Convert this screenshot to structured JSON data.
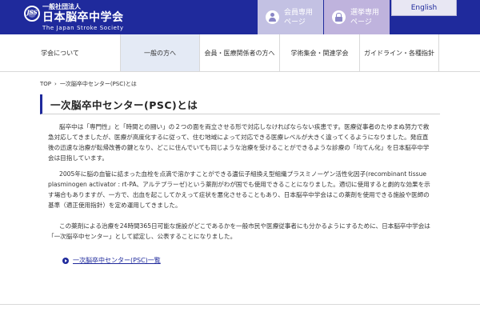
{
  "header": {
    "logo_sub": "一般社団法人",
    "logo_main": "日本脳卒中学会",
    "logo_en": "The Japan Stroke Society",
    "logo_mark": "JSS",
    "member_buttons": [
      {
        "line1": "会員専用",
        "line2": "ページ",
        "icon": "person-icon"
      },
      {
        "line1": "選挙専用",
        "line2": "ページ",
        "icon": "lock-icon"
      }
    ],
    "english_label": "English",
    "colors": {
      "primary": "#1f2a9c",
      "member1": "#c3c1e3",
      "member2": "#bfb3dd"
    }
  },
  "nav": {
    "items": [
      {
        "label": "学会について",
        "active": false
      },
      {
        "label": "一般の方へ",
        "active": true
      },
      {
        "label": "会員・医療関係者の方へ",
        "active": false
      },
      {
        "label": "学術集会・関連学会",
        "active": false
      },
      {
        "label": "ガイドライン・各種指針",
        "active": false
      }
    ]
  },
  "breadcrumb": {
    "home": "TOP",
    "separator": "›",
    "current": "一次脳卒中センター(PSC)とは"
  },
  "page": {
    "title": "一次脳卒中センター(PSC)とは",
    "paragraphs": [
      "脳卒中は「専門性」と「時間との闘い」の２つの面を両立させる形で対応しなければならない疾患です。医療従事者のたゆまぬ努力で救急対応してきましたが、医療が高度化するに従って、住む地域によって対応できる医療レベルが大きく違ってくるようになりました。発症直後の迅速な治療が転帰改善の鍵となり、どこに住んでいても同じような治療を受けることができるような診療の「均てん化」を日本脳卒中学会は目指しています。",
      "2005年に脳の血管に詰まった血栓を点滴で溶かすことができる遺伝子組換え型組織プラスミノーゲン活性化因子(recombinant tissue plasminogen activator : rt-PA、アルテプラーゼ)という薬剤がわが国でも使用できることになりました。適切に使用すると劇的な効果を示す場合もありますが、一方で、出血を起こしてかえって症状を悪化させることもあり、日本脳卒中学会はこの薬剤を使用できる施設や医師の基準（適正使用指針）を定め運用してきました。",
      "この薬剤による治療を24時間365日可能な施設がどこであるかを一般市民や医療従事者にも分かるようにするために、日本脳卒中学会は「一次脳卒中センター」として認定し、公表することになりました。"
    ],
    "link_label": "一次脳卒中センター(PSC)一覧"
  }
}
